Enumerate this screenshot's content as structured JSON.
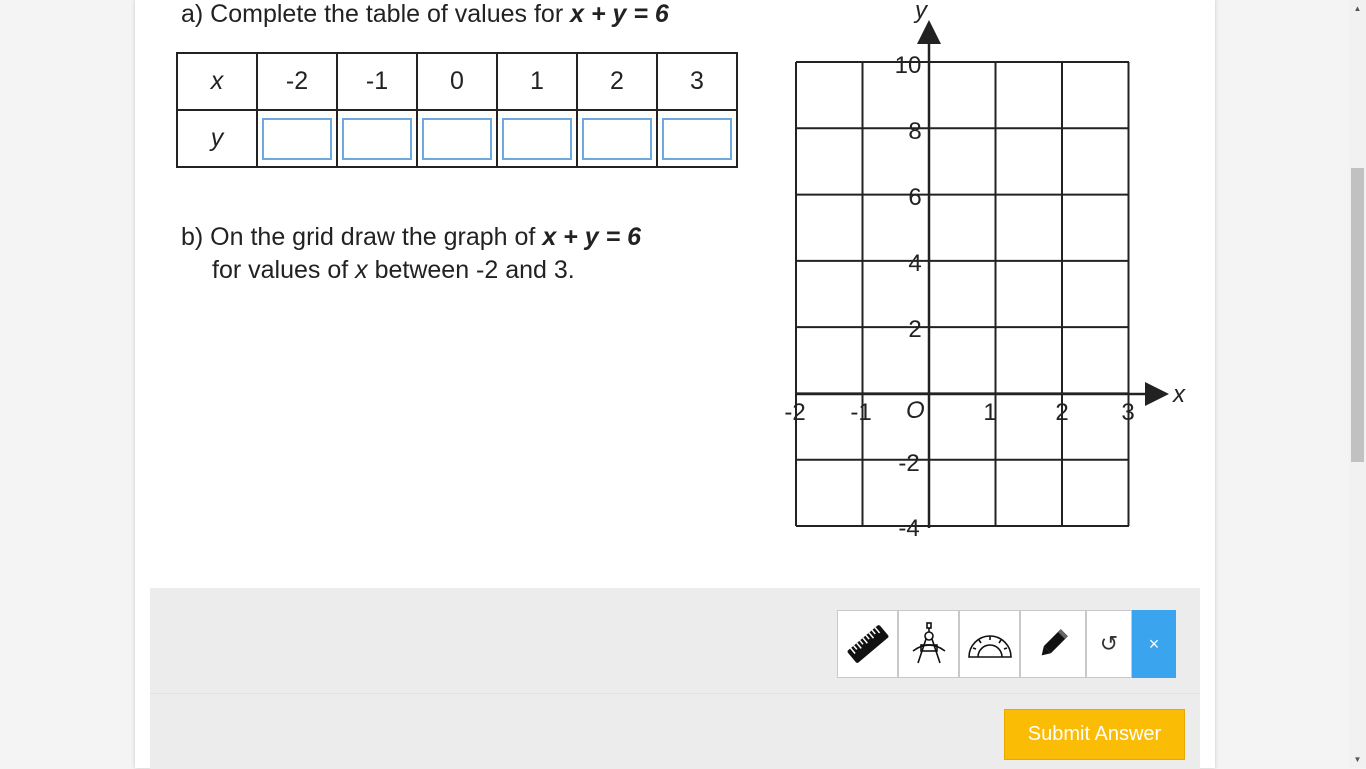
{
  "question": {
    "a": {
      "prefix": "a) Complete the table of values for",
      "equation": "x + y = 6"
    },
    "b": {
      "prefix": "b) On the grid draw the graph of",
      "equation": "x + y = 6",
      "line2_pre": "for values of",
      "line2_var": "x",
      "line2_post": "between -2 and 3."
    }
  },
  "table": {
    "x_label": "x",
    "y_label": "y",
    "x_values": [
      "-2",
      "-1",
      "0",
      "1",
      "2",
      "3"
    ],
    "y_values": [
      "",
      "",
      "",
      "",
      "",
      ""
    ]
  },
  "grid": {
    "x_axis_label": "x",
    "y_axis_label": "y",
    "origin_label": "O",
    "x_ticks": [
      "-2",
      "-1",
      "1",
      "2",
      "3"
    ],
    "y_ticks": [
      "10",
      "8",
      "6",
      "4",
      "2",
      "-2",
      "-4"
    ]
  },
  "toolbar": {
    "tools": [
      "ruler-icon",
      "compass-icon",
      "protractor-icon",
      "pencil-icon"
    ],
    "undo_icon": "↺",
    "close_icon": "×"
  },
  "footer": {
    "submit_label": "Submit Answer"
  },
  "colors": {
    "input_border": "#6fa8dc",
    "close_button": "#3ba4ee",
    "submit_button": "#fbbc05"
  }
}
